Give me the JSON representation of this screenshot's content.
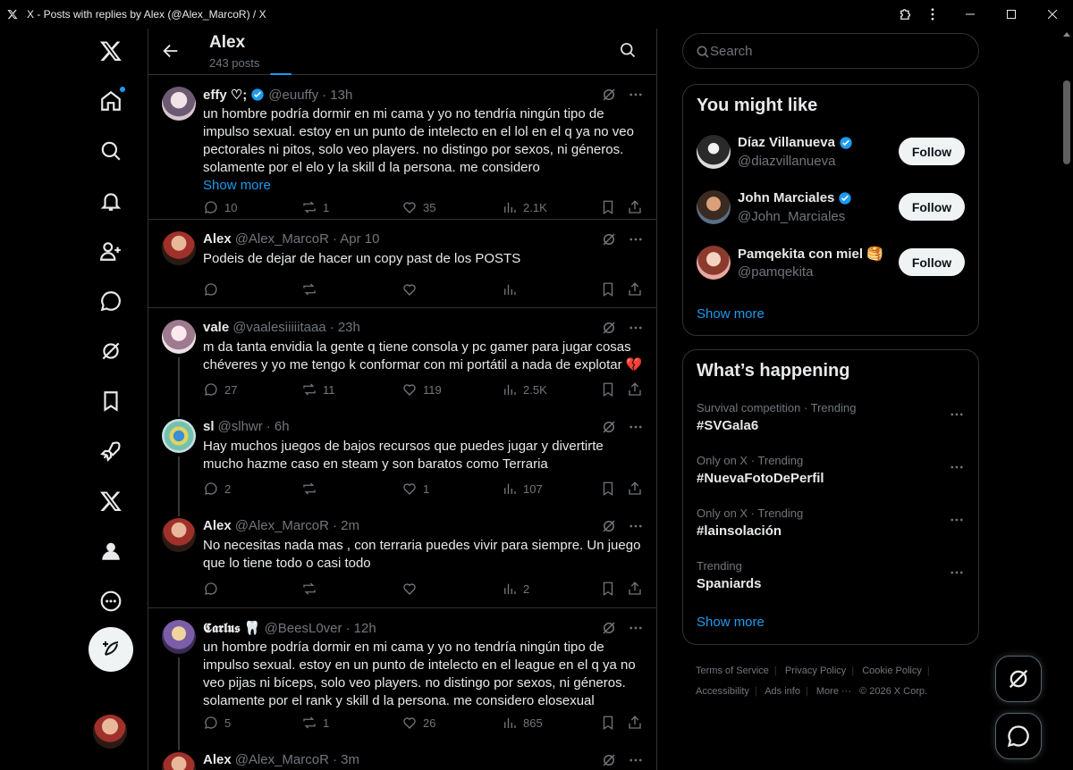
{
  "window": {
    "title": "X - Posts with replies by Alex (@Alex_MarcoR) / X"
  },
  "header": {
    "name": "Alex",
    "post_count": "243 posts"
  },
  "posts": [
    {
      "name": "effy ♡;",
      "handle": "@euuffy",
      "time": "· 13h",
      "verified": true,
      "text": "un hombre podría dormir en mi cama y yo no tendría ningún tipo de impulso sexual. estoy en un punto de intelecto en el lol en el q ya no veo pectorales ni pitos, solo veo players. no distingo por sexos, ni géneros. solamente por el elo y la skill d la persona. me considero",
      "show_more": "Show more",
      "replies": "10",
      "reposts": "1",
      "likes": "35",
      "views": "2.1K"
    },
    {
      "name": "Alex",
      "handle": "@Alex_MarcoR",
      "time": "· Apr 10",
      "text": "Podeis de dejar de hacer un copy past de los POSTS",
      "replies": "",
      "reposts": "",
      "likes": "",
      "views": ""
    },
    {
      "name": "vale",
      "handle": "@vaalesiiiiitaaa",
      "time": "· 23h",
      "text": "m da tanta envidia la gente q tiene consola y pc gamer para jugar cosas chéveres y yo me tengo k conformar con mi portátil a nada de explotar 💔",
      "replies": "27",
      "reposts": "11",
      "likes": "119",
      "views": "2.5K"
    },
    {
      "name": "sl",
      "handle": "@slhwr",
      "time": "· 6h",
      "text": "Hay muchos juegos de bajos recursos que puedes jugar y divertirte mucho hazme caso en steam y son baratos como Terraria",
      "replies": "2",
      "reposts": "",
      "likes": "1",
      "views": "107"
    },
    {
      "name": "Alex",
      "handle": "@Alex_MarcoR",
      "time": "· 2m",
      "text": "No necesitas nada mas , con terraria puedes vivir para siempre. Un juego que lo tiene todo o casi todo",
      "replies": "",
      "reposts": "",
      "likes": "",
      "views": "2"
    },
    {
      "name": "𝕮𝖆𝖗𝖑𝖚𝖘 🦷",
      "handle": "@BeesL0ver",
      "time": "· 12h",
      "text": "un hombre podría dormir en mi cama y yo no tendría ningún tipo de impulso sexual. estoy en un punto de intelecto en el league en el q ya no veo pijas ni bíceps, solo veo players. no distingo por sexos, ni géneros. solamente por el rank y skill d la persona. me considero elosexual",
      "replies": "5",
      "reposts": "1",
      "likes": "26",
      "views": "865"
    },
    {
      "name": "Alex",
      "handle": "@Alex_MarcoR",
      "time": "· 3m"
    }
  ],
  "search": {
    "placeholder": "Search"
  },
  "you_might_like": {
    "title": "You might like",
    "follow_label": "Follow",
    "show_more": "Show more",
    "users": [
      {
        "name": "Díaz Villanueva",
        "handle": "@diazvillanueva",
        "verified": true
      },
      {
        "name": "John Marciales",
        "handle": "@John_Marciales",
        "verified": true
      },
      {
        "name": "Pamqekita con miel 🥞",
        "handle": "@pamqekita",
        "verified": false
      }
    ]
  },
  "whats_happening": {
    "title": "What’s happening",
    "show_more": "Show more",
    "trends": [
      {
        "meta": "Survival competition · Trending",
        "name": "#SVGala6"
      },
      {
        "meta": "Only on X · Trending",
        "name": "#NuevaFotoDePerfil"
      },
      {
        "meta": "Only on X · Trending",
        "name": "#lainsolación"
      },
      {
        "meta": "Trending",
        "name": "Spaniards"
      }
    ]
  },
  "footer": {
    "terms": "Terms of Service",
    "privacy": "Privacy Policy",
    "cookie": "Cookie Policy",
    "accessibility": "Accessibility",
    "ads": "Ads info",
    "more": "More ···",
    "copyright": "© 2026 X Corp."
  },
  "colors": {
    "accent": "#1d9bf0",
    "background": "#000000",
    "border": "#2f3336",
    "muted": "#71767b"
  }
}
